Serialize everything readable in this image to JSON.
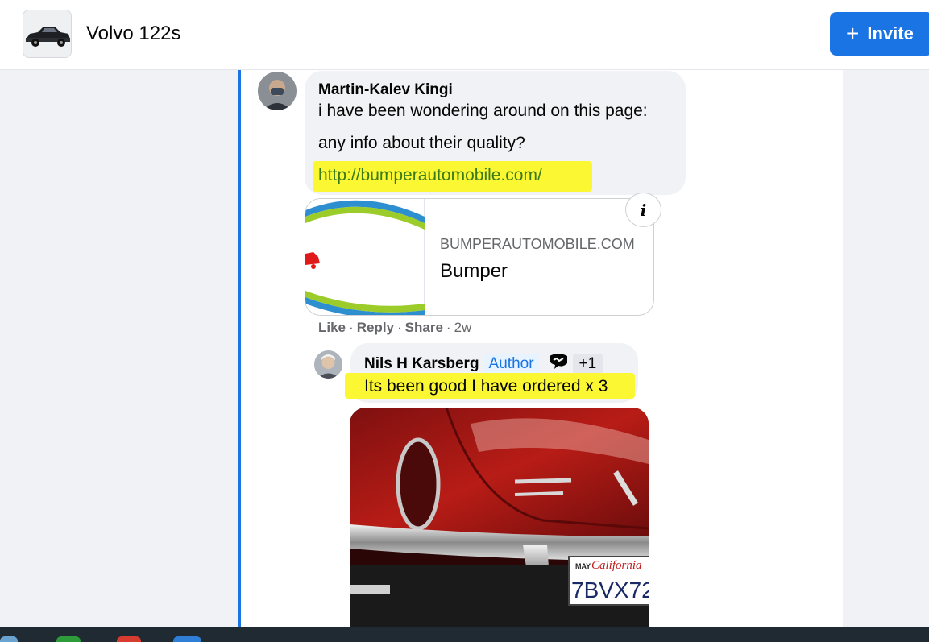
{
  "header": {
    "group_title": "Volvo 122s",
    "invite_label": "Invite"
  },
  "comment1": {
    "author": "Martin-Kalev Kingi",
    "line1": "i have been wondering around on this page:",
    "line2": "any info about their quality?",
    "link": "http://bumperautomobile.com/"
  },
  "preview": {
    "domain": "BUMPERAUTOMOBILE.COM",
    "title": "Bumper",
    "info_label": "i"
  },
  "actions": {
    "like": "Like",
    "reply": "Reply",
    "share": "Share",
    "time": "2w"
  },
  "reply": {
    "author": "Nils H Karsberg",
    "author_badge": "Author",
    "plus_badge": "+1",
    "text": "Its been good I have ordered x 3"
  },
  "photo": {
    "plate_state": "California",
    "plate_month": "MAY",
    "plate_number": "7BVX72"
  },
  "colors": {
    "accent": "#1b74e4",
    "highlight": "#fbf833",
    "link": "#3a7a1a"
  },
  "icons": {
    "plus": "plus-icon",
    "info": "info-icon",
    "fan": "top-fan-icon"
  }
}
